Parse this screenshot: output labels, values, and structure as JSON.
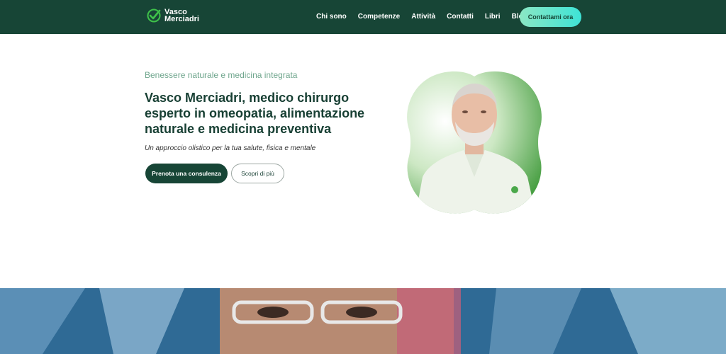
{
  "header": {
    "logo_line1": "Vasco",
    "logo_line2": "Merciadri",
    "nav": [
      {
        "label": "Chi sono"
      },
      {
        "label": "Competenze"
      },
      {
        "label": "Attività"
      },
      {
        "label": "Contatti"
      },
      {
        "label": "Libri"
      },
      {
        "label": "Blog"
      }
    ],
    "cta_label": "Contattami ora"
  },
  "hero": {
    "eyebrow": "Benessere naturale e medicina integrata",
    "title_name": "Vasco Merciadri",
    "title_rest": ", medico chirurgo esperto in omeopatia, alimentazione naturale e medicina preventiva",
    "subtitle": "Un approccio olistico per la tua salute, fisica e mentale",
    "primary_button": "Prenota una consulenza",
    "secondary_button": "Scopri di più"
  },
  "colors": {
    "header_bg": "#174536",
    "accent_green": "#6fa68d",
    "cta_gradient_start": "#8be7c4",
    "cta_gradient_end": "#3ee3d6"
  }
}
